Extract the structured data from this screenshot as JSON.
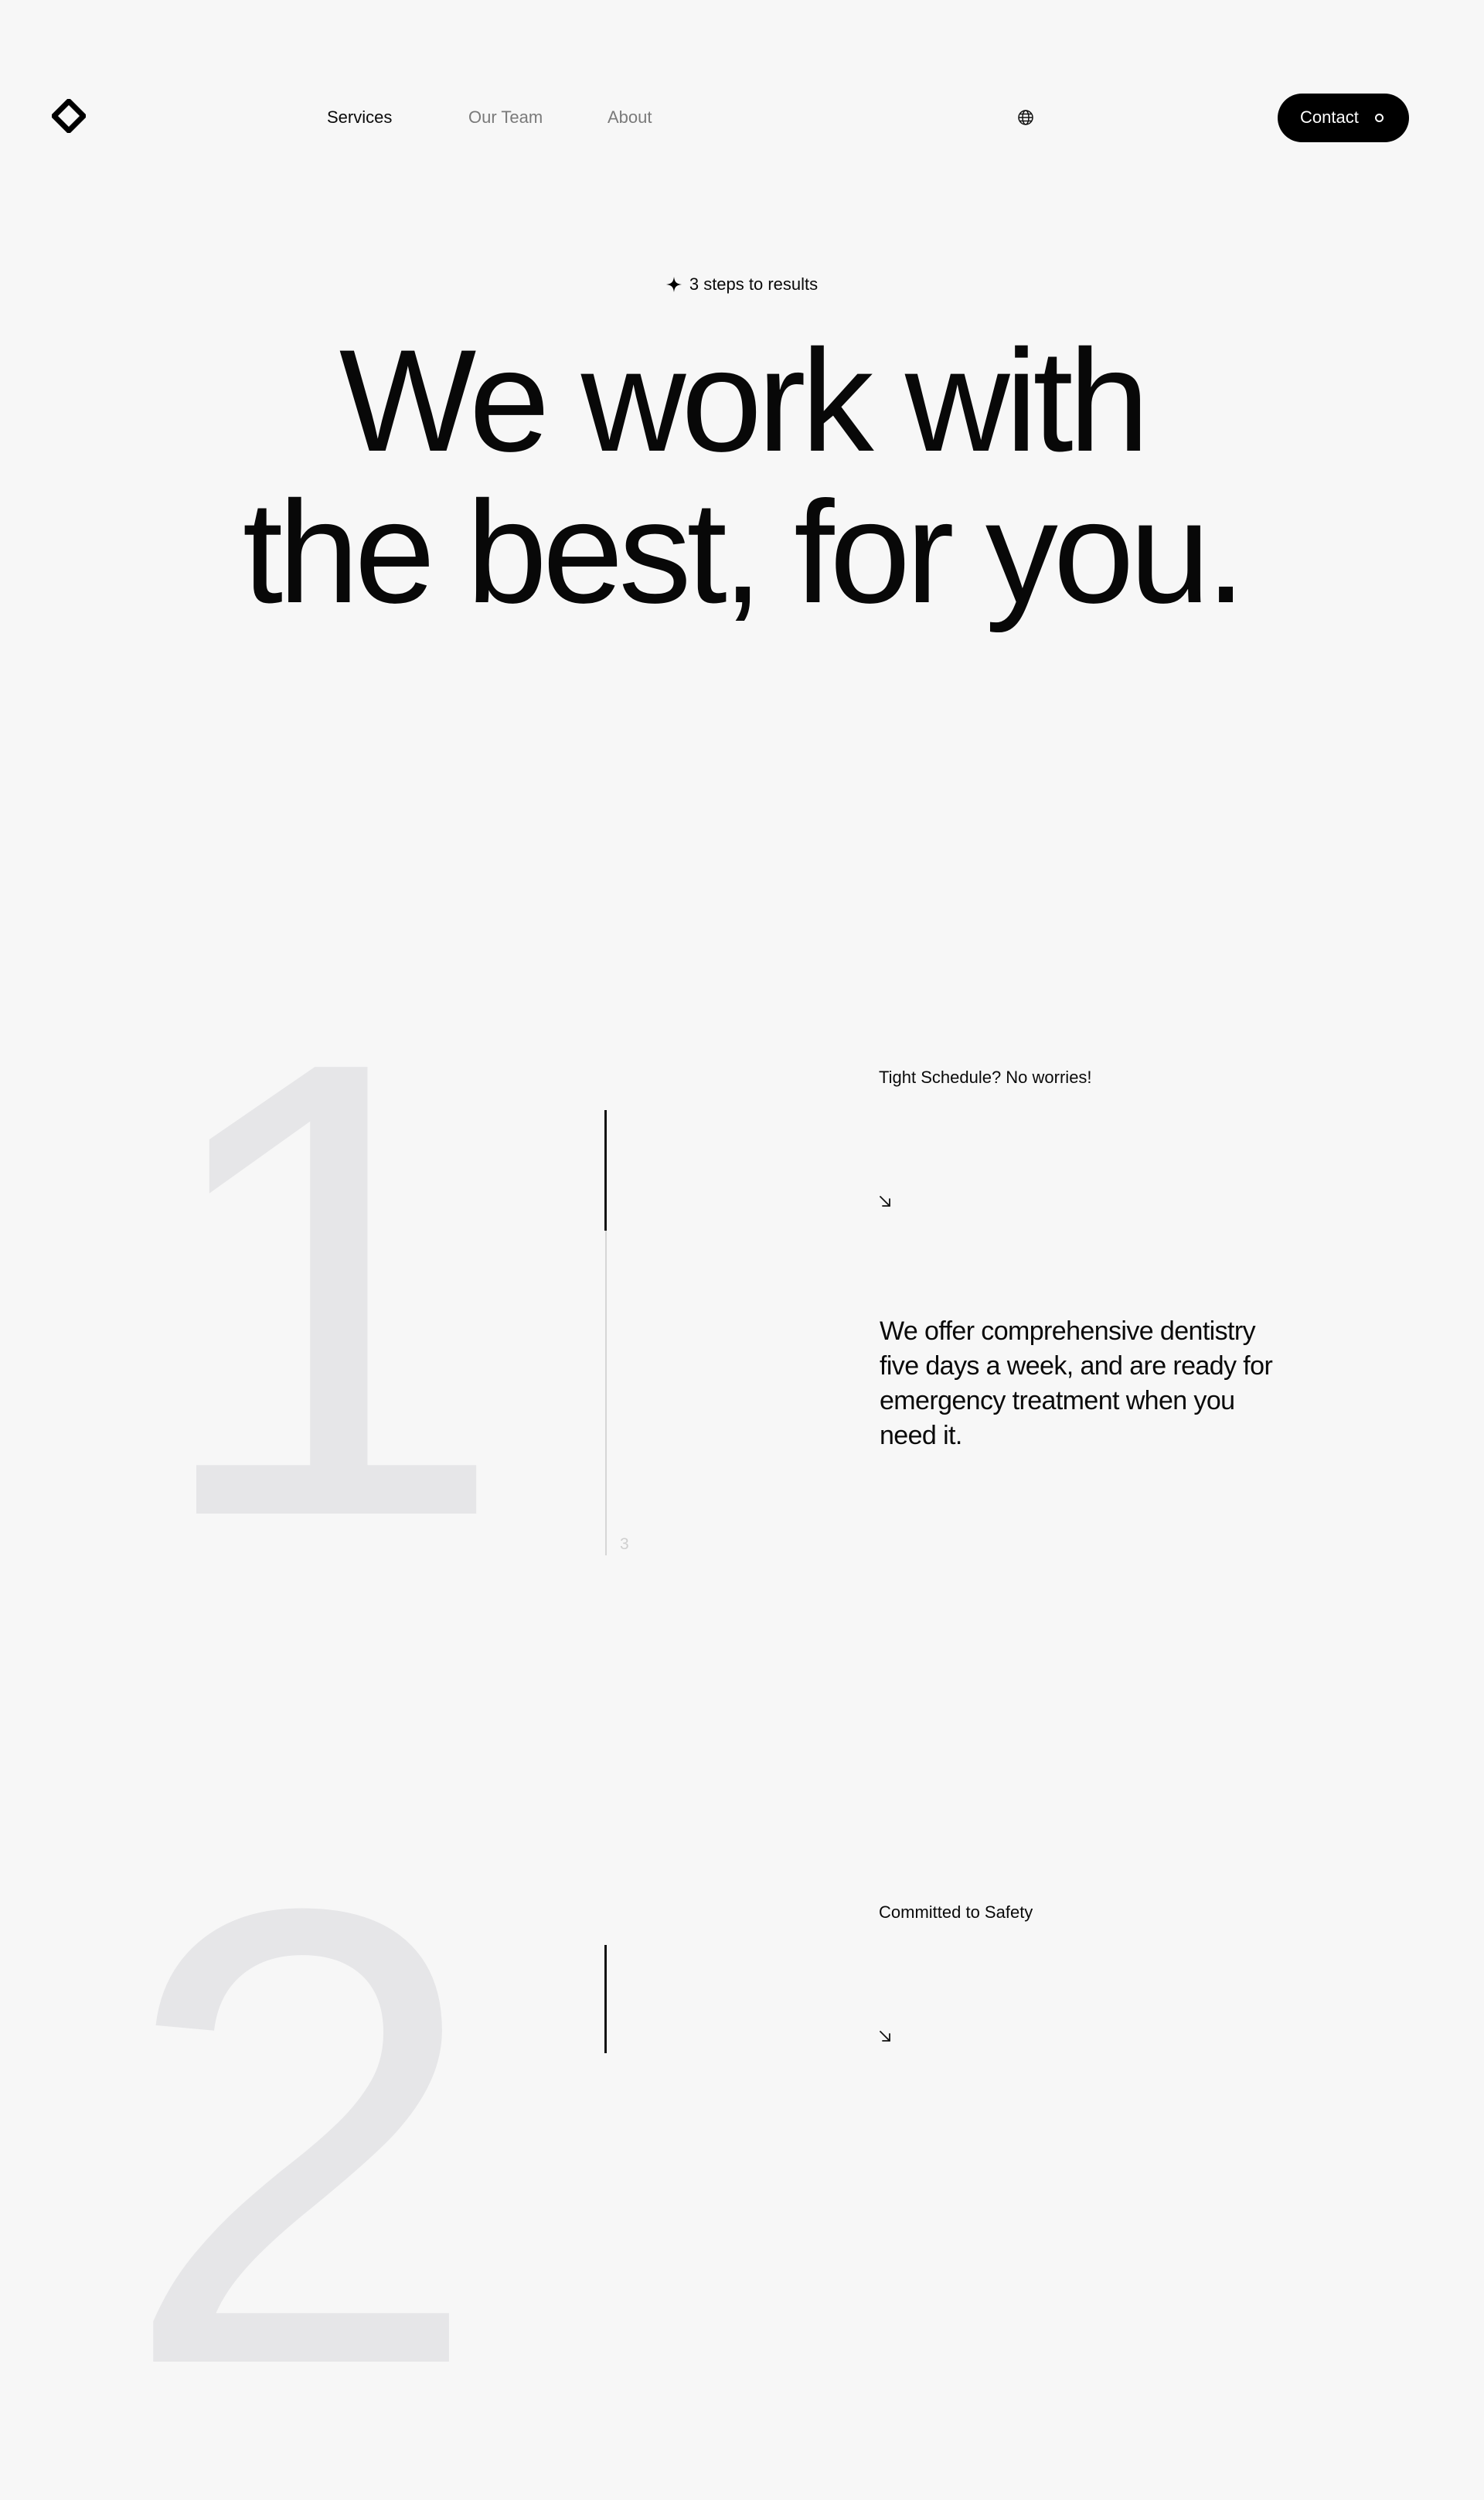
{
  "brand": {
    "logo_icon": "diamond-logo-icon"
  },
  "nav": {
    "items": [
      {
        "label": "Services",
        "active": true
      },
      {
        "label": "Our Team",
        "active": false
      },
      {
        "label": "About",
        "active": false
      }
    ],
    "language_icon": "globe-icon",
    "contact_label": "Contact"
  },
  "hero": {
    "eyebrow_icon": "sparkle-icon",
    "eyebrow": "3 steps to results",
    "title_line1": "We work with",
    "title_line2": "the best, for you."
  },
  "steps": [
    {
      "number": "1",
      "title": "Tight Schedule? No worries!",
      "arrow_icon": "arrow-down-right-icon",
      "description": "We offer comprehensive dentistry five days a week, and are ready for emergency treatment when you need it.",
      "total_steps": "3",
      "progress": 0.27
    },
    {
      "number": "2",
      "title": "Committed to Safety",
      "arrow_icon": "arrow-down-right-icon"
    }
  ],
  "colors": {
    "background": "#f7f7f7",
    "text": "#0a0a0a",
    "muted_text": "#7a7a7a",
    "button_bg": "#000000",
    "step_number": "#e6e6e8"
  }
}
